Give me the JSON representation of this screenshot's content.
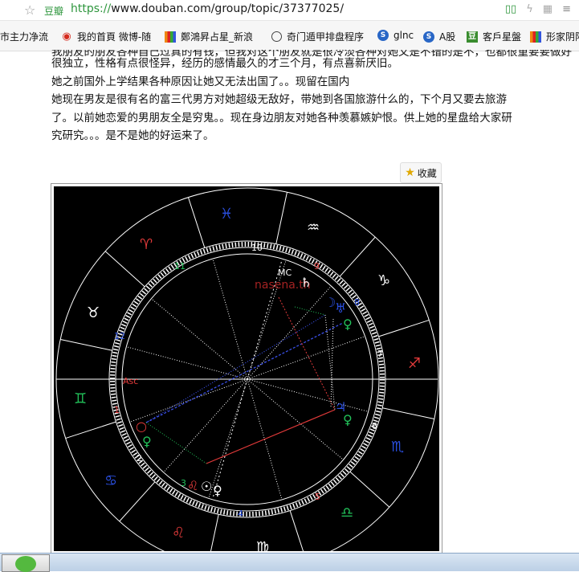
{
  "browser": {
    "site_label": "豆瓣",
    "url_scheme": "https://",
    "url_rest": "www.douban.com/group/topic/37377025/",
    "icons": [
      "bookmark-icon",
      "flash-icon",
      "qr-icon",
      "menu-icon"
    ]
  },
  "bookmarks": [
    {
      "label": "市主力净流",
      "icon": "none"
    },
    {
      "label": "我的首頁 微博-随",
      "icon": "weibo-icon"
    },
    {
      "label": "鄭鴻昇占星_新浪",
      "icon": "colorful-icon"
    },
    {
      "label": "奇门遁甲排盘程序",
      "icon": "globe-icon"
    },
    {
      "label": "glnc",
      "icon": "blue-circle-icon"
    },
    {
      "label": "A股",
      "icon": "blue-circle-icon"
    },
    {
      "label": "客戶星盤",
      "icon": "green-square-icon"
    },
    {
      "label": "形家阴阳",
      "icon": "colorful-icon"
    }
  ],
  "post": {
    "cut_line": "我朋友的朋友各种自己过真的有钱，但我对这个朋友就是很冷淡各种对她又是不错的是不，也都很重要要做好",
    "line1": "很独立，性格有点很怪异，经历的感情最久的才三个月，有点喜新厌旧。",
    "line2": "她之前国外上学结果各种原因让她又无法出国了。。现留在国内",
    "line3": "她现在男友是很有名的富三代男方对她超级无敌好，带她到各国旅游什么的，下个月又要去旅游",
    "line4": "了。以前她恋爱的男朋友全是穷鬼。。现在身边朋友对她各种羡慕嫉妒恨。供上她的星盘给大家研",
    "line5": "究研究。。。是不是她的好运来了。"
  },
  "collect_button": {
    "label": "收藏"
  },
  "chart": {
    "watermark": "nasena.th",
    "house_numbers": [
      "1",
      "2",
      "3",
      "4",
      "5",
      "6",
      "7",
      "8",
      "9",
      "10",
      "11",
      "12"
    ],
    "angle_labels": [
      "Asc",
      "MC"
    ],
    "colors": {
      "fire": "#e23a3a",
      "water": "#2a4fe0",
      "earth": "#ffffff",
      "air": "#22c25a",
      "line_red": "#e23a3a",
      "line_blue": "#3a4fe6"
    }
  }
}
